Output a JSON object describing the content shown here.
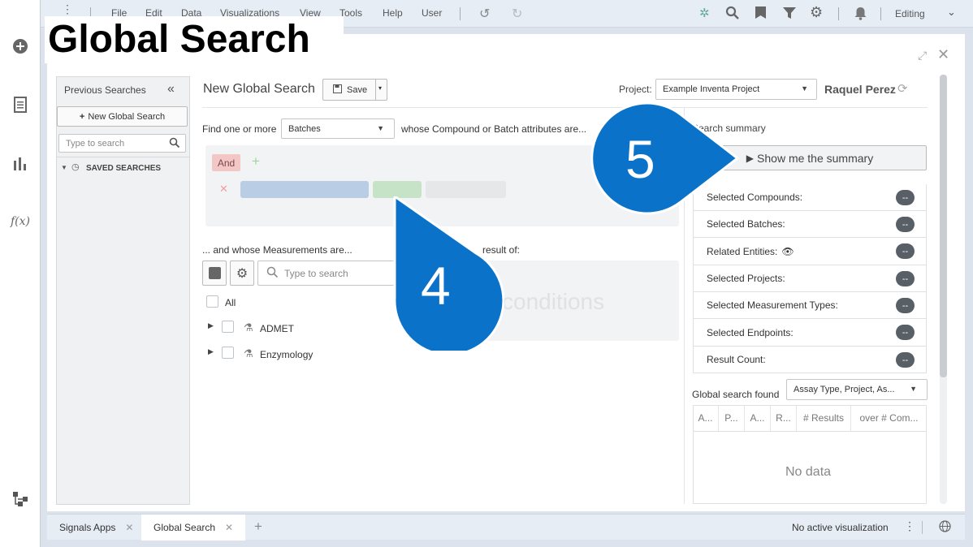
{
  "topbar": {
    "menus": [
      "File",
      "Edit",
      "Data",
      "Visualizations",
      "View",
      "Tools",
      "Help",
      "User"
    ],
    "mode": "Editing"
  },
  "overlay_title": "Global Search",
  "sidebar": {
    "title": "Previous Searches",
    "new_button": "New Global Search",
    "search_placeholder": "Type to search",
    "saved_label": "SAVED SEARCHES"
  },
  "header": {
    "title": "New Global Search",
    "save_label": "Save",
    "project_label": "Project:",
    "project_value": "Example Inventa Project",
    "user": "Raquel Perez"
  },
  "query": {
    "find_label": "Find one or more",
    "entity": "Batches",
    "whose_label": "whose Compound or Batch attributes are...",
    "and_chip": "And",
    "measurements_label": "... and whose Measurements are...",
    "result_label": "result of:",
    "conditions_placeholder": "conditions",
    "search_placeholder": "Type to search",
    "tree": [
      {
        "label": "All"
      },
      {
        "label": "ADMET"
      },
      {
        "label": "Enzymology"
      }
    ]
  },
  "callouts": {
    "first": "4",
    "second": "5"
  },
  "summary": {
    "title": "Search summary",
    "show_button": "Show me the summary",
    "rows": [
      {
        "label": "Selected Compounds:",
        "value": "--"
      },
      {
        "label": "Selected Batches:",
        "value": "--"
      },
      {
        "label": "Related Entities:",
        "value": "--"
      },
      {
        "label": "Selected Projects:",
        "value": "--"
      },
      {
        "label": "Selected Measurement Types:",
        "value": "--"
      },
      {
        "label": "Selected Endpoints:",
        "value": "--"
      },
      {
        "label": "Result Count:",
        "value": "--"
      }
    ],
    "found_label": "Global search found",
    "found_select": "Assay Type, Project, As...",
    "columns": [
      "A...",
      "P...",
      "A...",
      "R...",
      "# Results",
      "over # Com..."
    ],
    "empty": "No data"
  },
  "bottom": {
    "tabs": [
      "Signals Apps",
      "Global Search"
    ],
    "status": "No active visualization"
  },
  "colors": {
    "callout": "#0a73c9",
    "and_chip": "#f4c7c7",
    "accent_blue": "#b9cde4",
    "accent_green": "#c7e3c7"
  }
}
